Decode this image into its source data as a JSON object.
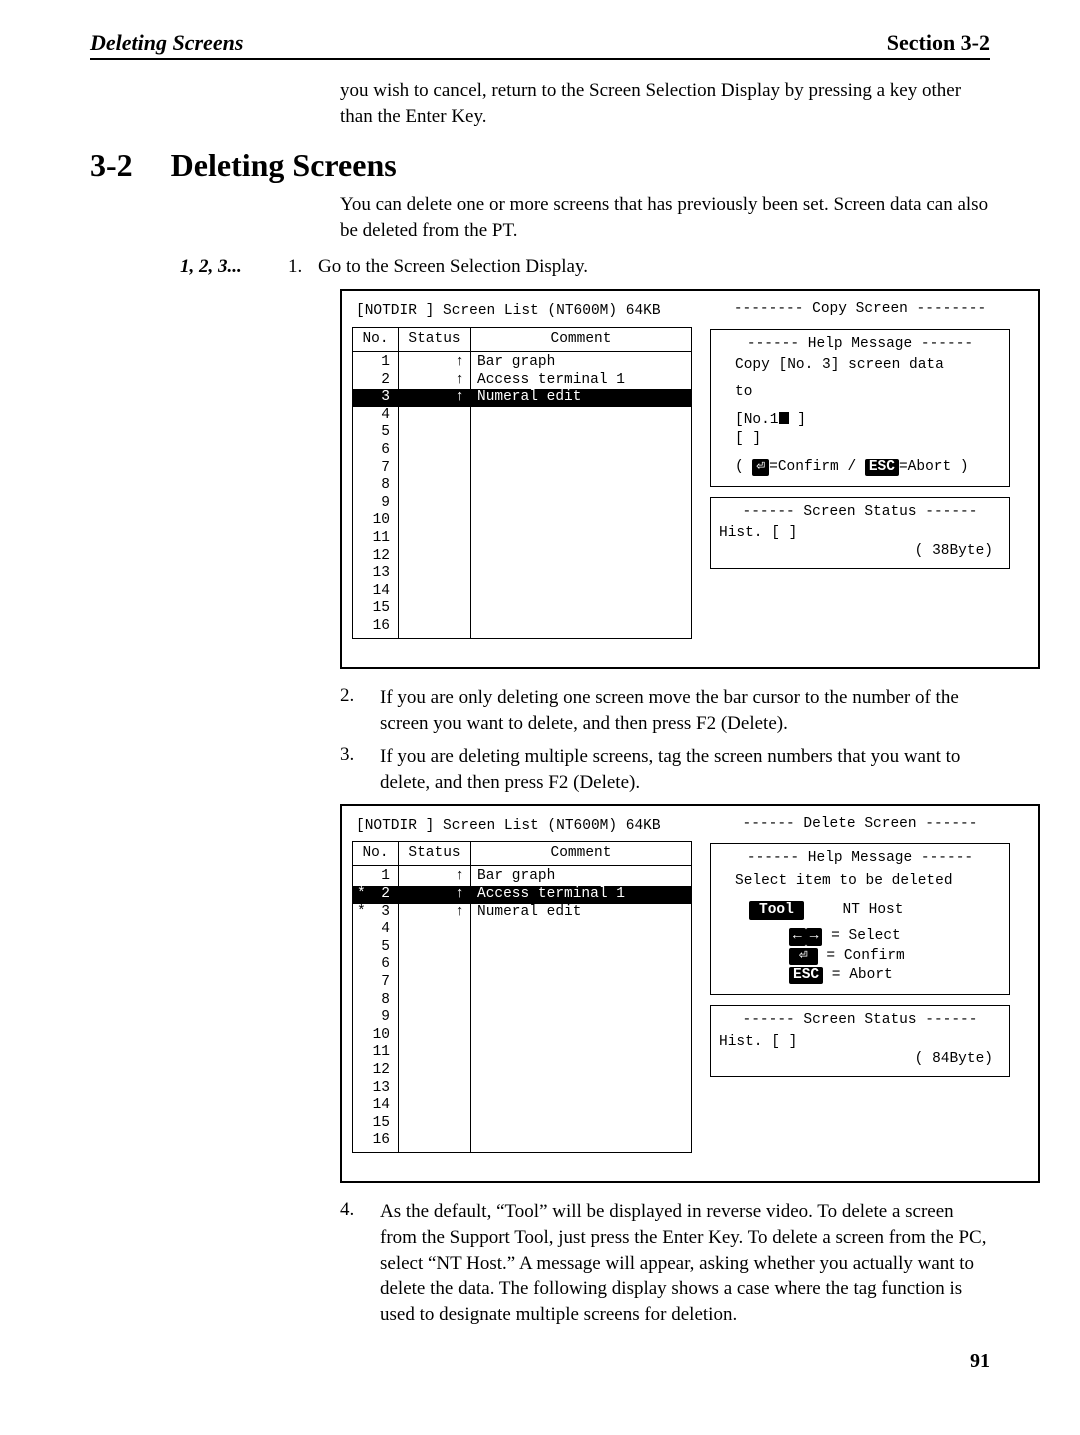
{
  "header": {
    "left": "Deleting Screens",
    "right": "Section 3-2"
  },
  "intro_prev": "you wish to cancel, return to the Screen Selection Display by pressing a key other than the Enter Key.",
  "h2": {
    "num": "3-2",
    "title": "Deleting Screens"
  },
  "intro": "You can delete one or more screens that has previously been set. Screen data can also be deleted from the PT.",
  "steps_lead": "1, 2, 3...",
  "steps": [
    {
      "n": "1.",
      "t": "Go to the Screen Selection Display."
    },
    {
      "n": "2.",
      "t": "If you are only deleting one screen move the bar cursor to the number of the screen you want to delete, and then press F2 (Delete)."
    },
    {
      "n": "3.",
      "t": "If you are deleting multiple screens, tag the screen numbers that you want to delete, and then press F2 (Delete)."
    },
    {
      "n": "4.",
      "t": "As the default, “Tool” will be displayed in reverse video. To delete a screen from the Support Tool, just press the Enter Key. To delete a screen from the PC, select “NT Host.” A message will appear, asking whether you actually want to delete the data. The following display shows a case where the tag function is used to designate multiple screens for deletion."
    }
  ],
  "fig_a": {
    "title_left": "[NOTDIR  ]  Screen List (NT600M)     64KB",
    "cols": {
      "no": "No.",
      "status": "Status",
      "comment": "Comment"
    },
    "rows": [
      {
        "no": "1",
        "status": "↑",
        "comment": "Bar graph"
      },
      {
        "no": "2",
        "status": "↑",
        "comment": "Access terminal 1"
      },
      {
        "no": "3",
        "status": "↑",
        "comment": "Numeral edit",
        "highlight": true
      },
      {
        "no": "4"
      },
      {
        "no": "5"
      },
      {
        "no": "6"
      },
      {
        "no": "7"
      },
      {
        "no": "8"
      },
      {
        "no": "9"
      },
      {
        "no": "10"
      },
      {
        "no": "11"
      },
      {
        "no": "12"
      },
      {
        "no": "13"
      },
      {
        "no": "14"
      },
      {
        "no": "15"
      },
      {
        "no": "16"
      }
    ],
    "right_title": "--------  Copy Screen  --------",
    "help_title": "------   Help Message   ------",
    "help_lines": {
      "l1": "Copy [No.   3] screen data",
      "l2": "to",
      "l3a": "[No.1",
      "l3b": "  ]",
      "l4": "[                       ]",
      "l5a": "( ",
      "l5b": "=Confirm / ",
      "l5c": "=Abort )"
    },
    "status_title": "------  Screen Status  ------",
    "status_hist": "Hist. [                       ]",
    "status_size": "(     38Byte)"
  },
  "fig_b": {
    "title_left": "[NOTDIR  ]  Screen List (NT600M)     64KB",
    "cols": {
      "no": "No.",
      "status": "Status",
      "comment": "Comment"
    },
    "rows": [
      {
        "no": "1",
        "status": "↑",
        "comment": "Bar graph"
      },
      {
        "no": "2",
        "status": "↑",
        "comment": "Access terminal 1",
        "highlight": true,
        "star": true
      },
      {
        "no": "3",
        "status": "↑",
        "comment": "Numeral edit",
        "star": true
      },
      {
        "no": "4"
      },
      {
        "no": "5"
      },
      {
        "no": "6"
      },
      {
        "no": "7"
      },
      {
        "no": "8"
      },
      {
        "no": "9"
      },
      {
        "no": "10"
      },
      {
        "no": "11"
      },
      {
        "no": "12"
      },
      {
        "no": "13"
      },
      {
        "no": "14"
      },
      {
        "no": "15"
      },
      {
        "no": "16"
      }
    ],
    "right_title": "------  Delete Screen  ------",
    "help_title": "------   Help Message   ------",
    "help_lines": {
      "l1": "Select item to be deleted",
      "l2a": "Tool",
      "l2b": "NT Host",
      "l3": " = Select",
      "l4": " = Confirm",
      "l5": " = Abort"
    },
    "status_title": "------  Screen Status  ------",
    "status_hist": "Hist. [                       ]",
    "status_size": "(     84Byte)"
  },
  "page_no": "91"
}
